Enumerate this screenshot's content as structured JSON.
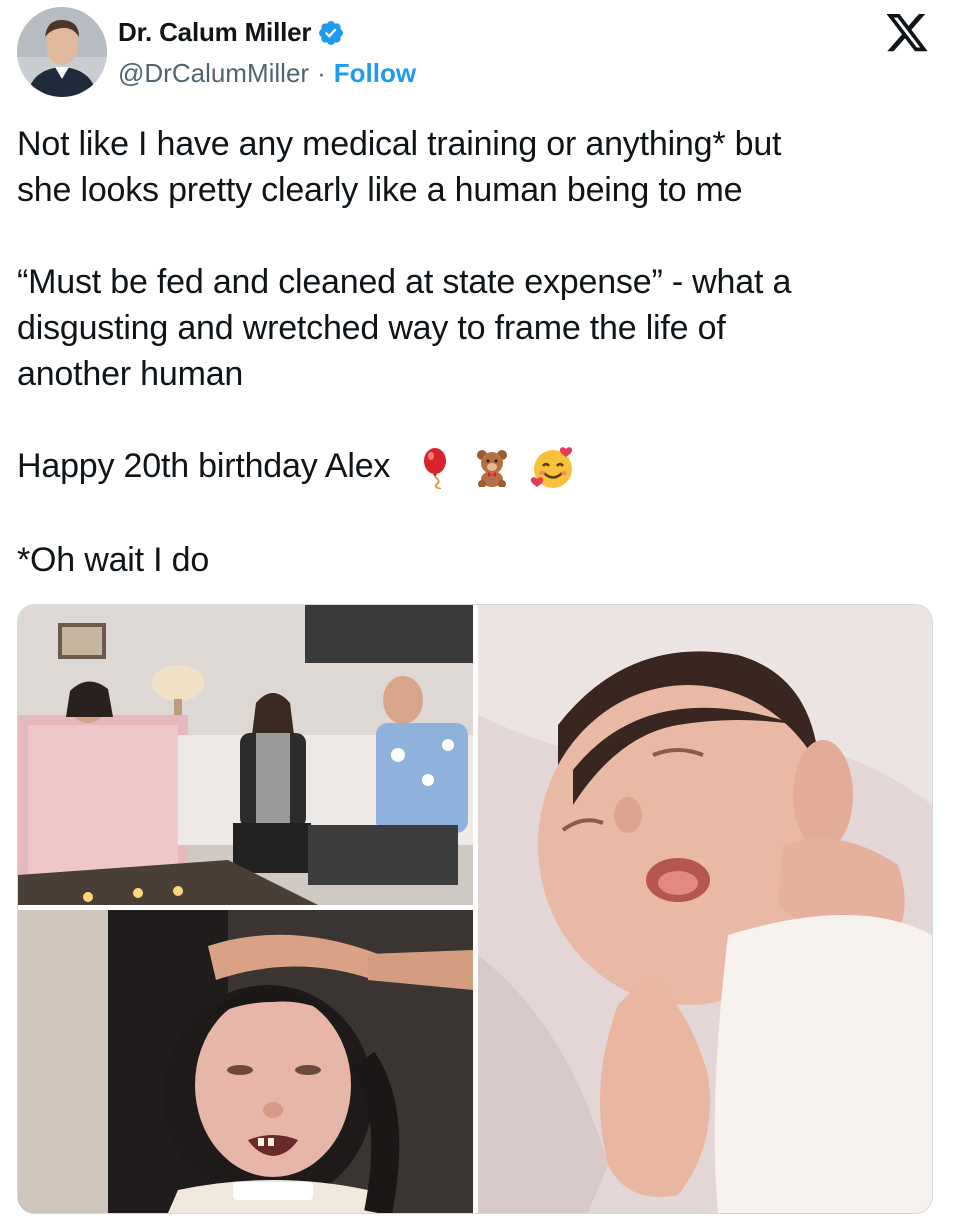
{
  "author": {
    "name": "Dr. Calum Miller",
    "handle": "@DrCalumMiller",
    "separator": "·",
    "follow_label": "Follow"
  },
  "tweet": {
    "lines": [
      "Not like I have any medical training or anything* but",
      "she looks pretty clearly like a human being to me",
      "“Must be fed and cleaned at state expense” - what a",
      "disgusting and wretched way to frame the life of",
      "another human",
      "Happy 20th birthday Alex",
      "*Oh wait I do"
    ],
    "emojis": [
      "balloon-emoji",
      "teddy-bear-emoji",
      "smiling-face-with-hearts-emoji"
    ]
  },
  "colors": {
    "accent": "#1d9bf0",
    "text": "#0f1419",
    "secondary": "#536471",
    "border": "#cfd9de"
  },
  "media": {
    "photos": [
      "family-living-room-photo",
      "young-woman-hand-on-head-photo",
      "sleeping-baby-photo"
    ]
  }
}
